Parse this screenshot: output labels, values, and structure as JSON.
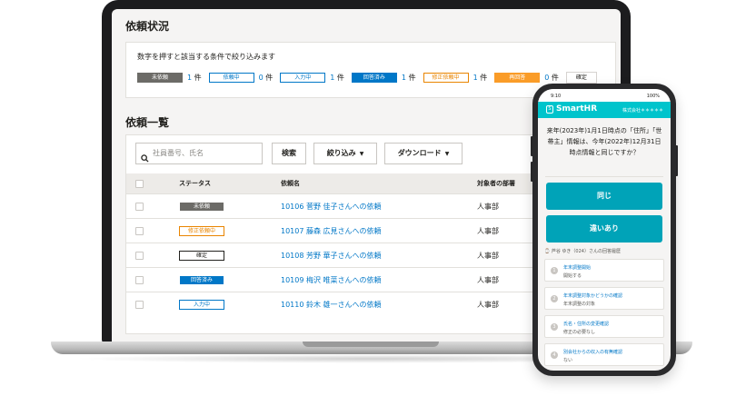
{
  "laptop": {
    "status_section": {
      "title": "依頼状況",
      "hint": "数字を押すと該当する条件で絞り込みます",
      "filters": [
        {
          "label": "未依頼",
          "count": "1",
          "unit": "件",
          "style": "gray"
        },
        {
          "label": "依頼中",
          "count": "0",
          "unit": "件",
          "style": "blue-outline"
        },
        {
          "label": "入力中",
          "count": "1",
          "unit": "件",
          "style": "blue-outline"
        },
        {
          "label": "回答済み",
          "count": "1",
          "unit": "件",
          "style": "blue"
        },
        {
          "label": "修正依頼中",
          "count": "1",
          "unit": "件",
          "style": "orange-outline"
        },
        {
          "label": "再回答",
          "count": "0",
          "unit": "件",
          "style": "orange"
        }
      ],
      "confirm_label": "確定"
    },
    "list_section": {
      "title": "依頼一覧",
      "search_placeholder": "社員番号、氏名",
      "search_button": "検索",
      "filter_button": "絞り込み",
      "download_button": "ダウンロード",
      "columns": {
        "status": "ステータス",
        "request_name": "依頼名",
        "department": "対象者の部署"
      },
      "rows": [
        {
          "status": "未依頼",
          "status_style": "gray",
          "request_name": "10106 菅野 佳子さんへの依頼",
          "department": "人事部"
        },
        {
          "status": "修正依頼中",
          "status_style": "orange-outline",
          "request_name": "10107 藤森 広見さんへの依頼",
          "department": "人事部"
        },
        {
          "status": "確定",
          "status_style": "neutral",
          "request_name": "10108 芳野 華子さんへの依頼",
          "department": "人事部"
        },
        {
          "status": "回答済み",
          "status_style": "blue",
          "request_name": "10109 梅沢 唯菜さんへの依頼",
          "department": "人事部"
        },
        {
          "status": "入力中",
          "status_style": "blue-outline",
          "request_name": "10110 鈴木 雄一さんへの依頼",
          "department": "人事部"
        }
      ]
    }
  },
  "phone": {
    "status_time": "9:10",
    "status_right": "100%",
    "app_name": "SmartHR",
    "company_name": "株式会社＊＊＊＊＊",
    "question": "来年(2023年)1月1日時点の「住所」「世帯主」情報は、今年(2022年)12月31日時点情報と同じですか？",
    "answer_same": "同じ",
    "answer_different": "違いあり",
    "history_title": "芦谷 ゆき（024）さんの回答履歴",
    "history": [
      {
        "num": "1",
        "question": "年末調整開始",
        "answer": "開始する"
      },
      {
        "num": "2",
        "question": "年末調整対象かどうかの確認",
        "answer": "年末調整の対象"
      },
      {
        "num": "3",
        "question": "氏名・住所の変更確認",
        "answer": "修正の必要なし"
      },
      {
        "num": "4",
        "question": "別会社からの収入の有無確認",
        "answer": "ない"
      }
    ]
  },
  "colors": {
    "accent_teal": "#00c4cc",
    "answer_button": "#00a3b8",
    "link_blue": "#0077c7",
    "status_gray": "#6c6b67",
    "status_orange": "#fa9c28"
  }
}
